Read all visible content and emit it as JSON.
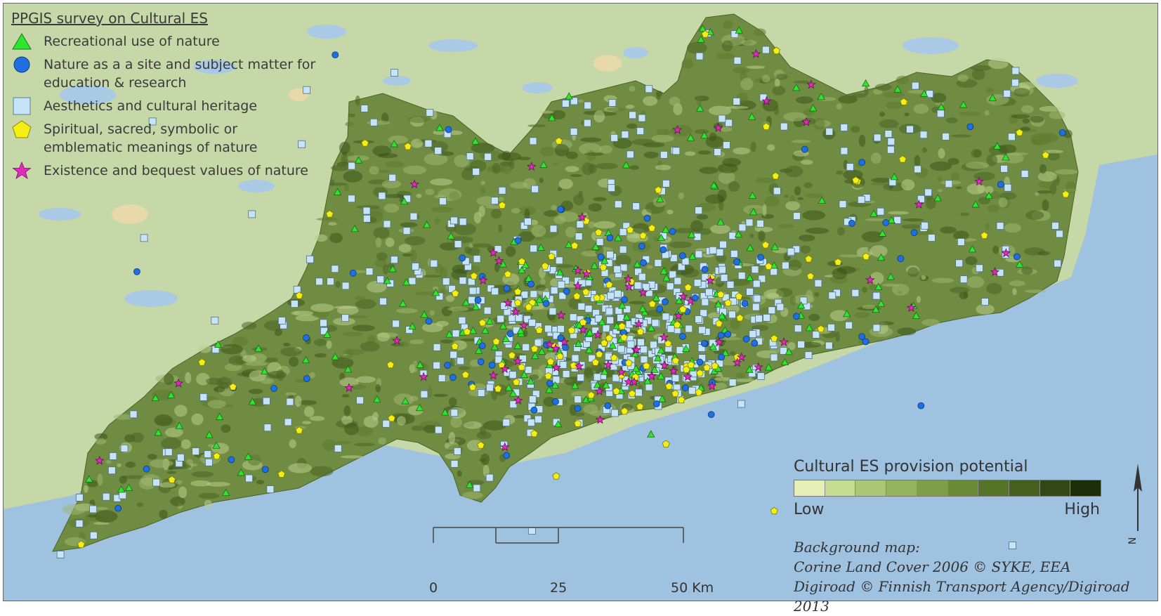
{
  "legend": {
    "title": "PPGIS survey on Cultural ES",
    "items": [
      {
        "label": "Recreational use of nature",
        "symbol": "triangle",
        "color": "#2ee62e"
      },
      {
        "label": "Nature as a a site and subject matter for education & research",
        "symbol": "circle",
        "color": "#1f6fe0"
      },
      {
        "label": "Aesthetics and cultural heritage",
        "symbol": "square",
        "color": "#c6e4f7"
      },
      {
        "label": "Spiritual, sacred, symbolic or emblematic meanings of nature",
        "symbol": "pentagon",
        "color": "#f2ee16"
      },
      {
        "label": "Existence and bequest values of nature",
        "symbol": "star",
        "color": "#e02bbd"
      }
    ]
  },
  "ramp": {
    "title": "Cultural ES provision potential",
    "low_label": "Low",
    "high_label": "High",
    "colors": [
      "#e6f0b6",
      "#c7dc93",
      "#abc676",
      "#95b45f",
      "#7e9f47",
      "#6a8a37",
      "#567428",
      "#445f1e",
      "#324715",
      "#1e2e0a"
    ]
  },
  "scale_bar": {
    "labels": [
      "0",
      "25",
      "50 Km"
    ]
  },
  "north_label": "N",
  "credits": [
    "Background map:",
    "Corine Land Cover 2006 © SYKE, EEA",
    "Digiroad © Finnish Transport Agency/Digiroad 2013"
  ],
  "colors": {
    "sea": "#9fc2e0",
    "land_background": "#c6d8a8",
    "study_area": "#6f8c42",
    "study_area_dark": "#4a6424",
    "study_area_light": "#b9cd8a",
    "frame": "#666666"
  },
  "point_counts": {
    "recreational": 220,
    "education": 90,
    "aesthetics": 600,
    "spiritual": 130,
    "existence": 70
  }
}
